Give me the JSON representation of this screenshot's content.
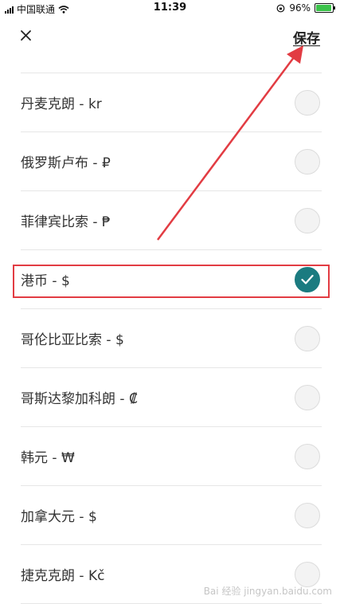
{
  "status_bar": {
    "carrier": "中国联通",
    "time": "11:39",
    "battery": "96%",
    "battery_level": 0.96
  },
  "header": {
    "close_icon": "close-icon",
    "save_label": "保存"
  },
  "currencies": [
    {
      "label": "丹麦克朗 - kr",
      "selected": false
    },
    {
      "label": "俄罗斯卢布 - ₽",
      "selected": false
    },
    {
      "label": "菲律宾比索 - ₱",
      "selected": false
    },
    {
      "label": "港币 - $",
      "selected": true
    },
    {
      "label": "哥伦比亚比索 - $",
      "selected": false
    },
    {
      "label": "哥斯达黎加科朗 - ₡",
      "selected": false
    },
    {
      "label": "韩元 - ₩",
      "selected": false
    },
    {
      "label": "加拿大元 - $",
      "selected": false
    },
    {
      "label": "捷克克朗 - Kč",
      "selected": false
    }
  ],
  "colors": {
    "selected_accent": "#1b7b80",
    "annotation_red": "#e23c43"
  },
  "watermark": "Bai 经验 jingyan.baidu.com"
}
